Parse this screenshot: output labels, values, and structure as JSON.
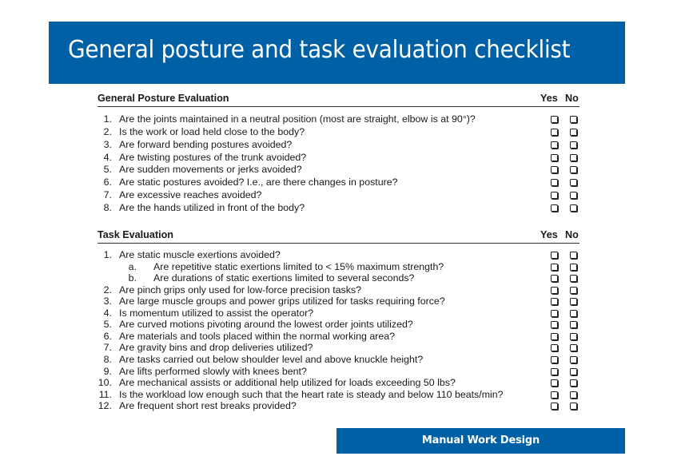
{
  "slide": {
    "title": "General posture and task evaluation checklist",
    "footer": "Manual Work Design",
    "colors": {
      "brand_blue": "#0060a6",
      "text": "#1a1a1a",
      "background": "#ffffff"
    }
  },
  "checklist": {
    "general_posture": {
      "title": "General Posture Evaluation",
      "col_yes": "Yes",
      "col_no": "No",
      "items": [
        {
          "num": "1.",
          "text": "Are the joints maintained in a neutral position (most are straight, elbow is at 90°)?"
        },
        {
          "num": "2.",
          "text": "Is the work or load held close to the body?"
        },
        {
          "num": "3.",
          "text": "Are forward bending postures avoided?"
        },
        {
          "num": "4.",
          "text": "Are twisting postures of the trunk avoided?"
        },
        {
          "num": "5.",
          "text": "Are sudden movements or jerks avoided?"
        },
        {
          "num": "6.",
          "text": "Are static postures avoided? I.e., are there changes in posture?"
        },
        {
          "num": "7.",
          "text": "Are excessive reaches avoided?"
        },
        {
          "num": "8.",
          "text": "Are the hands utilized in front of the body?"
        }
      ]
    },
    "task_evaluation": {
      "title": "Task Evaluation",
      "col_yes": "Yes",
      "col_no": "No",
      "items": [
        {
          "num": "1.",
          "text": "Are static muscle exertions avoided?",
          "sub": false
        },
        {
          "num": "a.",
          "text": "Are repetitive static exertions limited to < 15% maximum strength?",
          "sub": true
        },
        {
          "num": "b.",
          "text": "Are durations of static exertions limited to several seconds?",
          "sub": true
        },
        {
          "num": "2.",
          "text": "Are pinch grips only used for low-force precision tasks?",
          "sub": false
        },
        {
          "num": "3.",
          "text": "Are large muscle groups and power grips utilized for tasks requiring force?",
          "sub": false
        },
        {
          "num": "4.",
          "text": "Is momentum utilized to assist the operator?",
          "sub": false
        },
        {
          "num": "5.",
          "text": "Are curved motions pivoting around the lowest order joints utilized?",
          "sub": false
        },
        {
          "num": "6.",
          "text": "Are materials and tools placed within the normal working area?",
          "sub": false
        },
        {
          "num": "7.",
          "text": "Are gravity bins and drop deliveries utilized?",
          "sub": false
        },
        {
          "num": "8.",
          "text": "Are tasks carried out below shoulder level and above knuckle height?",
          "sub": false
        },
        {
          "num": "9.",
          "text": "Are lifts performed slowly with knees bent?",
          "sub": false
        },
        {
          "num": "10.",
          "text": "Are mechanical assists or additional help utilized for loads exceeding 50 lbs?",
          "sub": false
        },
        {
          "num": "11.",
          "text": "Is the workload low enough such that the heart rate is steady and below 110 beats/min?",
          "sub": false
        },
        {
          "num": "12.",
          "text": "Are frequent short rest breaks provided?",
          "sub": false
        }
      ]
    }
  }
}
